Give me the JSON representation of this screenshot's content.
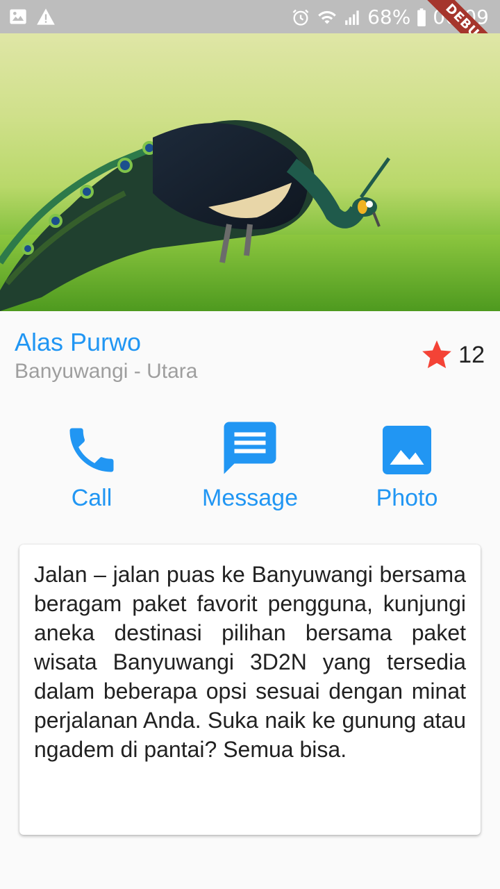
{
  "status_bar": {
    "battery": "68%",
    "time": "06:09",
    "debug_label": "DEBUG"
  },
  "hero": {
    "subject": "peacock"
  },
  "place": {
    "name": "Alas Purwo",
    "location": "Banyuwangi - Utara",
    "rating_count": "12",
    "star_color": "#f44336"
  },
  "actions": [
    {
      "label": "Call",
      "icon": "phone-icon"
    },
    {
      "label": "Message",
      "icon": "message-icon"
    },
    {
      "label": "Photo",
      "icon": "photo-icon"
    }
  ],
  "description": "Jalan – jalan puas ke Banyuwangi bersama beragam paket favorit pengguna, kunjungi aneka destinasi pilihan bersama paket wisata Banyuwangi 3D2N yang tersedia dalam beberapa opsi sesuai dengan minat perjalanan Anda. Suka naik ke gunung atau ngadem di pantai? Semua bisa.",
  "colors": {
    "accent": "#2196f3",
    "secondary_text": "#9e9e9e"
  }
}
